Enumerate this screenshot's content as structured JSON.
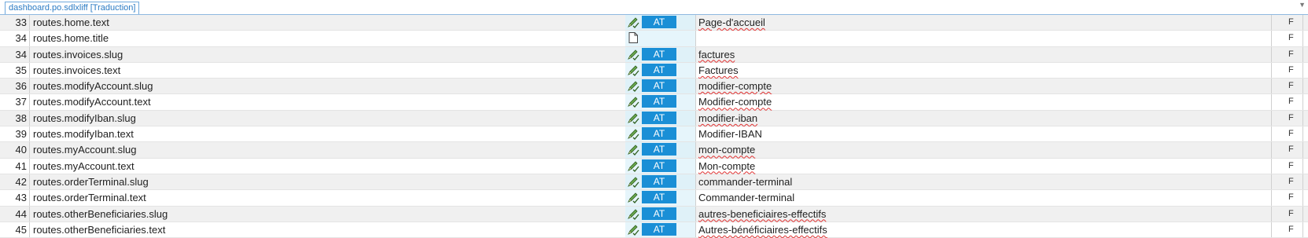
{
  "tab": {
    "label": "dashboard.po.sdlxliff [Traduction]"
  },
  "menu_arrow": "▼",
  "rows": [
    {
      "num": "33",
      "key": "routes.home.text",
      "status": "AT",
      "target": "Page-d'accueil",
      "type": "at",
      "spell": true,
      "flag": "F"
    },
    {
      "num": "34",
      "key": "routes.home.title",
      "status": "",
      "target": "",
      "type": "doc",
      "spell": false,
      "flag": "F"
    },
    {
      "num": "34",
      "key": "routes.invoices.slug",
      "status": "AT",
      "target": "factures",
      "type": "at",
      "spell": true,
      "flag": "F"
    },
    {
      "num": "35",
      "key": "routes.invoices.text",
      "status": "AT",
      "target": "Factures",
      "type": "at",
      "spell": true,
      "flag": "F"
    },
    {
      "num": "36",
      "key": "routes.modifyAccount.slug",
      "status": "AT",
      "target": "modifier-compte",
      "type": "at",
      "spell": true,
      "flag": "F"
    },
    {
      "num": "37",
      "key": "routes.modifyAccount.text",
      "status": "AT",
      "target": "Modifier-compte",
      "type": "at",
      "spell": true,
      "flag": "F"
    },
    {
      "num": "38",
      "key": "routes.modifyIban.slug",
      "status": "AT",
      "target": "modifier-iban",
      "type": "at",
      "spell": true,
      "flag": "F"
    },
    {
      "num": "39",
      "key": "routes.modifyIban.text",
      "status": "AT",
      "target": "Modifier-IBAN",
      "type": "at",
      "spell": false,
      "flag": "F"
    },
    {
      "num": "40",
      "key": "routes.myAccount.slug",
      "status": "AT",
      "target": "mon-compte",
      "type": "at",
      "spell": true,
      "flag": "F"
    },
    {
      "num": "41",
      "key": "routes.myAccount.text",
      "status": "AT",
      "target": "Mon-compte",
      "type": "at",
      "spell": true,
      "flag": "F"
    },
    {
      "num": "42",
      "key": "routes.orderTerminal.slug",
      "status": "AT",
      "target": "commander-terminal",
      "type": "at",
      "spell": false,
      "flag": "F"
    },
    {
      "num": "43",
      "key": "routes.orderTerminal.text",
      "status": "AT",
      "target": "Commander-terminal",
      "type": "at",
      "spell": false,
      "flag": "F"
    },
    {
      "num": "44",
      "key": "routes.otherBeneficiaries.slug",
      "status": "AT",
      "target": "autres-beneficiaires-effectifs",
      "type": "at",
      "spell": true,
      "flag": "F"
    },
    {
      "num": "45",
      "key": "routes.otherBeneficiaries.text",
      "status": "AT",
      "target": "Autres-bénéficiaires-effectifs",
      "type": "at",
      "spell": true,
      "flag": "F"
    }
  ]
}
